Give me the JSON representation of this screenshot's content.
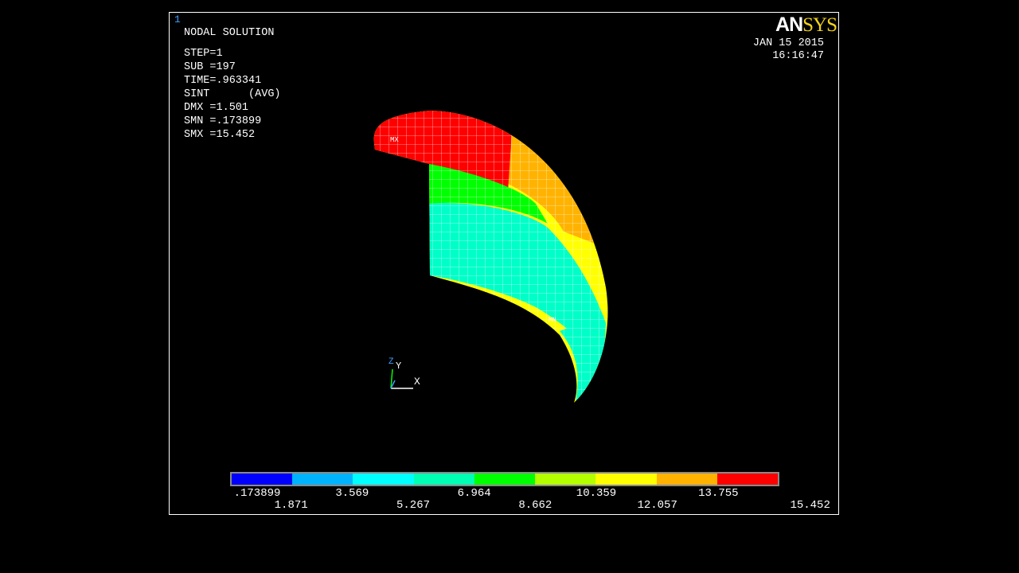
{
  "window": {
    "number": "1",
    "logo": {
      "left": "AN",
      "right": "SYS"
    },
    "date": "JAN 15 2015",
    "time": "16:16:47"
  },
  "info": {
    "title": "NODAL SOLUTION",
    "step": "STEP=1",
    "sub": "SUB =197",
    "time": "TIME=.963341",
    "sint": "SINT      (AVG)",
    "dmx": "DMX =1.501",
    "smn": "SMN =.173899",
    "smx": "SMX =15.452"
  },
  "model_labels": {
    "mx": "MX",
    "mn": "MN"
  },
  "triad": {
    "z": "Z",
    "y": "Y",
    "x": "X"
  },
  "legend": {
    "colors": [
      "#0000ff",
      "#00b3ff",
      "#00ffff",
      "#00ffb3",
      "#00ff00",
      "#b3ff00",
      "#ffff00",
      "#ffb300",
      "#ff0000"
    ],
    "top_labels": [
      ".173899",
      "3.569",
      "6.964",
      "10.359",
      "13.755"
    ],
    "bottom_labels": [
      "1.871",
      "5.267",
      "8.662",
      "12.057",
      "15.452"
    ]
  }
}
